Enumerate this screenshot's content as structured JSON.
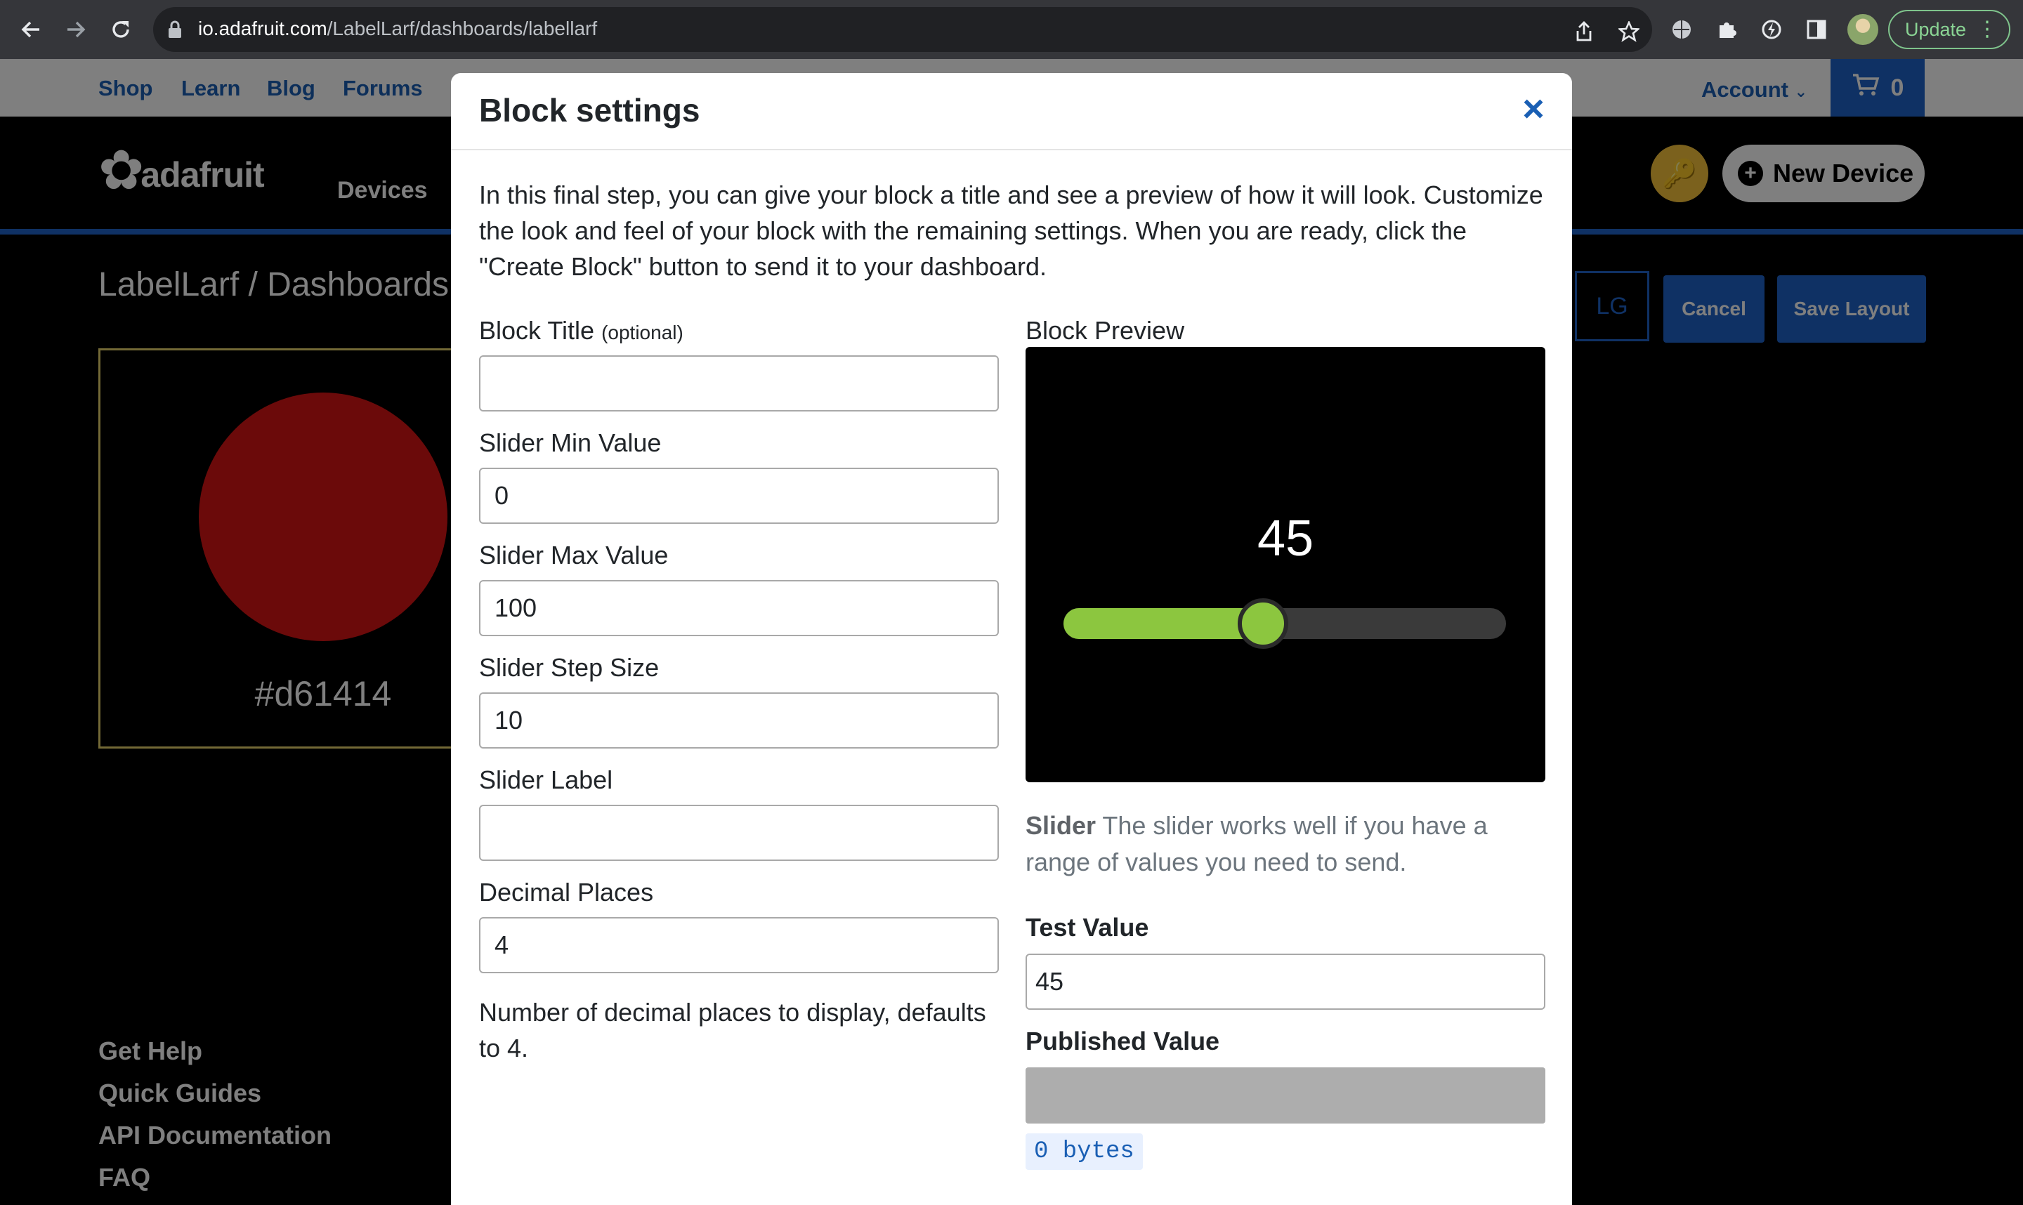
{
  "browser": {
    "url_host": "io.adafruit.com",
    "url_path": "/LabelLarf/dashboards/labellarf",
    "update_label": "Update"
  },
  "site_nav": {
    "links": [
      "Shop",
      "Learn",
      "Blog",
      "Forums"
    ],
    "account_label": "Account",
    "cart_count": "0"
  },
  "header": {
    "logo_text": "adafruit",
    "devices_label": "Devices",
    "new_device_label": "New Device"
  },
  "dashboard": {
    "breadcrumb": "LabelLarf / Dashboards /",
    "size_button": "LG",
    "cancel_label": "Cancel",
    "save_label": "Save Layout",
    "color_value": "#d61414",
    "color_label": "#d61414"
  },
  "footer": {
    "links": [
      "Get Help",
      "Quick Guides",
      "API Documentation",
      "FAQ"
    ]
  },
  "modal": {
    "title": "Block settings",
    "close_symbol": "×",
    "intro": "In this final step, you can give your block a title and see a preview of how it will look. Customize the look and feel of your block with the remaining settings. When you are ready, click the \"Create Block\" button to send it to your dashboard.",
    "fields": {
      "block_title_label": "Block Title",
      "block_title_optional": "(optional)",
      "block_title_value": "",
      "min_label": "Slider Min Value",
      "min_value": "0",
      "max_label": "Slider Max Value",
      "max_value": "100",
      "step_label": "Slider Step Size",
      "step_value": "10",
      "slider_label_label": "Slider Label",
      "slider_label_value": "",
      "decimal_label": "Decimal Places",
      "decimal_value": "4",
      "decimal_help": "Number of decimal places to display, defaults to 4."
    },
    "preview": {
      "label": "Block Preview",
      "value": "45",
      "slider_min": 0,
      "slider_max": 100,
      "slider_value": 45,
      "fill_color": "#8cc63f"
    },
    "description": {
      "name": "Slider",
      "text": " The slider works well if you have a range of values you need to send."
    },
    "test_value_label": "Test Value",
    "test_value": "45",
    "published_value_label": "Published Value",
    "published_bytes": "0 bytes"
  }
}
